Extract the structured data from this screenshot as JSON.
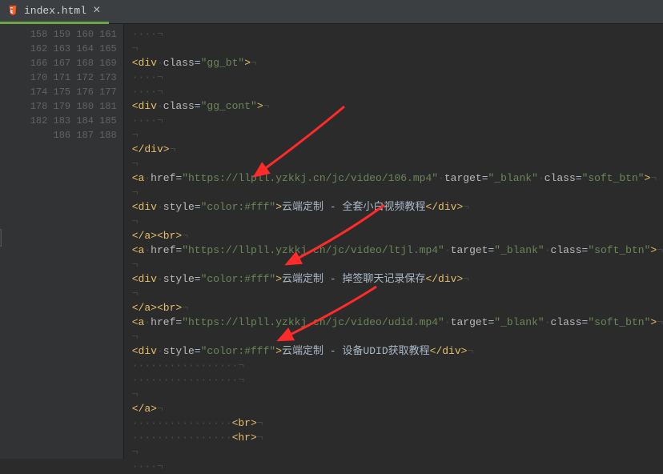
{
  "tab": {
    "icon_name": "html5-file-icon",
    "title": "index.html",
    "close": "×"
  },
  "lines": {
    "first": 158,
    "last": 188
  },
  "code": {
    "l158": {
      "ws": "····¬"
    },
    "l159": {
      "ws": "¬"
    },
    "l160": {
      "pre": "",
      "tag": "div",
      "a1n": "class",
      "a1v": "gg_bt",
      "ws_end": "¬"
    },
    "l161": {
      "ws": "····¬"
    },
    "l162": {
      "ws": "····¬"
    },
    "l163": {
      "pre": "",
      "tag": "div",
      "a1n": "class",
      "a1v": "gg_cont",
      "ws_end": "¬"
    },
    "l164": {
      "ws": "····¬"
    },
    "l165": {
      "ws": "¬"
    },
    "l166": {
      "close_tag": "div",
      "ws_end": "¬"
    },
    "l167": {
      "ws": "¬"
    },
    "l168": {
      "tag": "a",
      "a1n": "href",
      "a1v": "https://llpll.yzkkj.cn/jc/video/106.mp4",
      "a2n": "target",
      "a2v": "_blank",
      "a3n": "class",
      "a3v": "soft_btn",
      "ws_end": "¬"
    },
    "l169": {
      "ws": "¬"
    },
    "l170": {
      "tag": "div",
      "a1n": "style",
      "a1v": "color:#fff",
      "inner": "云端定制 - 全套小白视频教程",
      "close_tag": "div",
      "ws_end": "¬"
    },
    "l171": {
      "ws": "¬"
    },
    "l172": {
      "close_tag1": "a",
      "self_tag": "br",
      "ws_end": "¬"
    },
    "l173": {
      "tag": "a",
      "a1n": "href",
      "a1v": "https://llpll.yzkkj.cn/jc/video/ltjl.mp4",
      "a2n": "target",
      "a2v": "_blank",
      "a3n": "class",
      "a3v": "soft_btn",
      "ws_end": "¬"
    },
    "l174": {
      "ws": "¬"
    },
    "l175": {
      "tag": "div",
      "a1n": "style",
      "a1v": "color:#fff",
      "inner": "云端定制 - 掉签聊天记录保存",
      "close_tag": "div",
      "ws_end": "¬"
    },
    "l176": {
      "ws": "¬"
    },
    "l177": {
      "close_tag1": "a",
      "self_tag": "br",
      "ws_end": "¬"
    },
    "l178": {
      "tag": "a",
      "a1n": "href",
      "a1v": "https://llpll.yzkkj.cn/jc/video/udid.mp4",
      "a2n": "target",
      "a2v": "_blank",
      "a3n": "class",
      "a3v": "soft_btn",
      "ws_end": "¬"
    },
    "l179": {
      "ws": "¬"
    },
    "l180": {
      "tag": "div",
      "a1n": "style",
      "a1v": "color:#fff",
      "inner": "云端定制 - 设备UDID获取教程",
      "close_tag": "div",
      "ws_end": "¬"
    },
    "l181": {
      "ws": "·················¬"
    },
    "l182": {
      "ws": "·················¬"
    },
    "l183": {
      "ws": "¬"
    },
    "l184": {
      "close_tag": "a",
      "ws_end": "¬"
    },
    "l185": {
      "ws_pre": "················",
      "self_tag": "br",
      "ws_end": "¬"
    },
    "l186": {
      "ws_pre": "················",
      "self_tag": "hr",
      "ws_end": "¬"
    },
    "l187": {
      "ws": "¬"
    },
    "l188": {
      "ws": "····¬"
    }
  }
}
